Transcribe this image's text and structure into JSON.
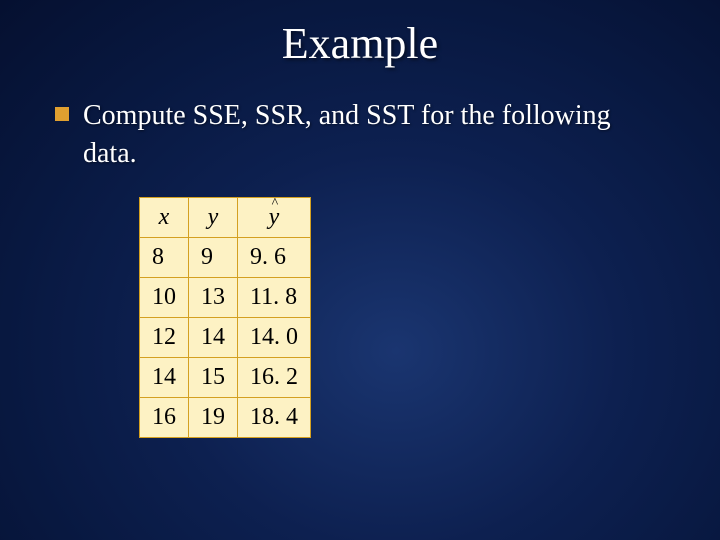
{
  "title": "Example",
  "body": "Compute SSE, SSR, and SST for the following data.",
  "table": {
    "headers": [
      "x",
      "y",
      "y^"
    ],
    "rows": [
      {
        "x": "8",
        "y": "9",
        "yhat": "9. 6"
      },
      {
        "x": "10",
        "y": "13",
        "yhat": "11. 8"
      },
      {
        "x": "12",
        "y": "14",
        "yhat": "14. 0"
      },
      {
        "x": "14",
        "y": "15",
        "yhat": "16. 2"
      },
      {
        "x": "16",
        "y": "19",
        "yhat": "18. 4"
      }
    ]
  },
  "chart_data": {
    "type": "table",
    "title": "Example",
    "columns": [
      "x",
      "y",
      "y_hat"
    ],
    "rows": [
      [
        8,
        9,
        9.6
      ],
      [
        10,
        13,
        11.8
      ],
      [
        12,
        14,
        14.0
      ],
      [
        14,
        15,
        16.2
      ],
      [
        16,
        19,
        18.4
      ]
    ]
  }
}
